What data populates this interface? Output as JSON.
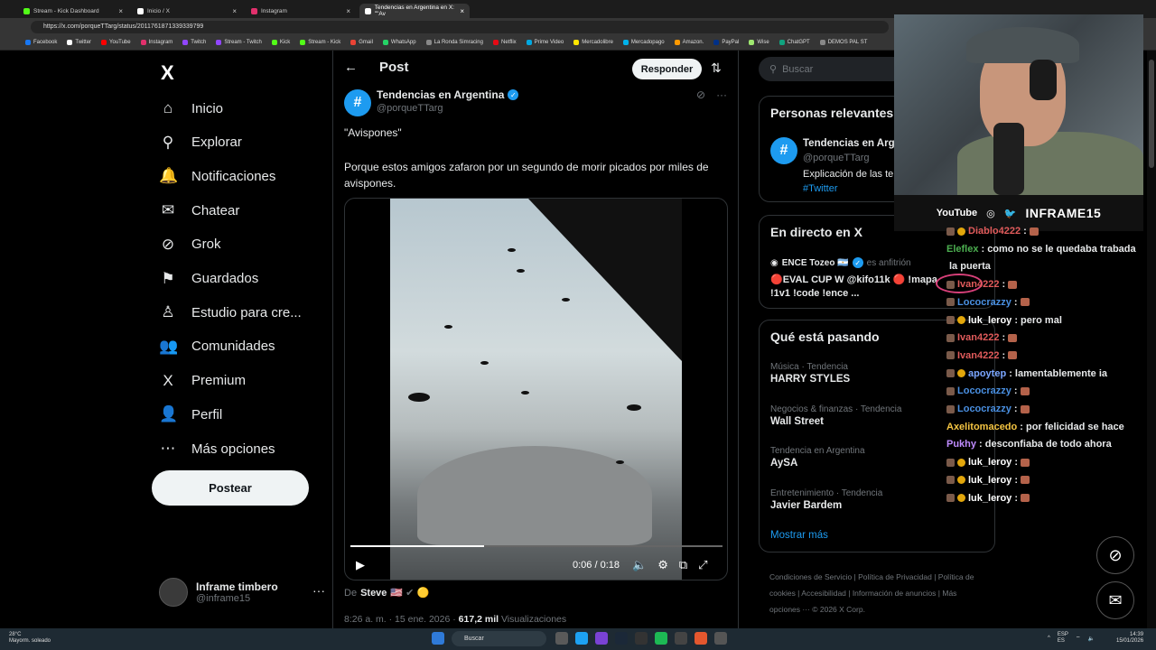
{
  "browser": {
    "tabs": [
      {
        "label": "Stream - Kick Dashboard",
        "color": "#53fc18"
      },
      {
        "label": "Inicio / X",
        "color": "#ffffff"
      },
      {
        "label": "Instagram",
        "color": "#e1306c"
      },
      {
        "label": "Tendencias en Argentina en X: \"\"Av",
        "color": "#ffffff"
      }
    ],
    "url": "https://x.com/porqueTTarg/status/2011761871339339799",
    "bookmarks": [
      "Facebook",
      "Twitter",
      "YouTube",
      "Instagram",
      "Twitch",
      "Stream - Twitch",
      "Kick",
      "Stream - Kick",
      "Gmail",
      "WhatsApp",
      "La Ronda Simracing",
      "Netflix",
      "Prime Video",
      "Mercadolibre",
      "Mercadopago",
      "Amazon.",
      "PayPal",
      "Wise",
      "ChatGPT",
      "DEMOS PAL ST"
    ]
  },
  "nav": {
    "items": [
      "Inicio",
      "Explorar",
      "Notificaciones",
      "Chatear",
      "Grok",
      "Guardados",
      "Estudio para cre...",
      "Comunidades",
      "Premium",
      "Perfil",
      "Más opciones"
    ],
    "icons": [
      "⌂",
      "⚲",
      "🔔",
      "✉",
      "⊘",
      "⚑",
      "♙",
      "👥",
      "X",
      "👤",
      "⋯"
    ],
    "post_label": "Postear",
    "profile_name": "Inframe timbero",
    "profile_handle": "@inframe15",
    "profile_more": "···"
  },
  "post": {
    "header": "Post",
    "reply_label": "Responder",
    "author_name": "Tendencias en Argentina",
    "author_handle": "@porqueTTarg",
    "title_text": "\"Avispones\"",
    "body": "Porque estos amigos zafaron por un segundo de morir picados por miles de avispones.",
    "video_time": "0:06 / 0:18",
    "video_progress": 0.36,
    "via_prefix": "De",
    "via_name": "Steve",
    "via_flags": "🇺🇸 ✔ 🟡",
    "time": "8:26 a. m. · 15 ene. 2026 ·",
    "views": "617,2 mil",
    "views_label": "Visualizaciones"
  },
  "sidebar": {
    "search_placeholder": "Buscar",
    "relevant_title": "Personas relevantes",
    "relevant_name": "Tendencias en Arge",
    "relevant_handle": "@porqueTTarg",
    "relevant_desc": "Explicación de las te",
    "relevant_tag": "#Twitter",
    "live_title": "En directo en X",
    "live_host": "ENCE Tozeo 🇦🇷",
    "live_host_role": "es anfitrión",
    "live_text": "🔴EVAL CUP W @kifo11k 🔴 !mapa !1v1 !code !ence ...",
    "trends_title": "Qué está pasando",
    "trends": [
      {
        "cat": "Música · Tendencia",
        "topic": "HARRY STYLES"
      },
      {
        "cat": "Negocios & finanzas · Tendencia",
        "topic": "Wall Street"
      },
      {
        "cat": "Tendencia en Argentina",
        "topic": "AySA"
      },
      {
        "cat": "Entretenimiento · Tendencia",
        "topic": "Javier Bardem"
      }
    ],
    "show_more": "Mostrar más",
    "footer": "Condiciones de Servicio | Política de Privacidad | Política de cookies | Accesibilidad | Información de anuncios | Más opciones ··· © 2026 X Corp."
  },
  "stream": {
    "youtube": "YouTube",
    "brand": "INFRAME15"
  },
  "chat": [
    {
      "user": "Diablo4222",
      "color": "#e05b5b",
      "msg": ":",
      "emote": true,
      "badge": "y"
    },
    {
      "user": "Eleflex",
      "color": "#4caf50",
      "msg": ": como no se le quedaba trabada",
      "badge": "none"
    },
    {
      "user": "",
      "color": "#ffffff",
      "msg": "la puerta",
      "badge": "none"
    },
    {
      "user": "Ivan4222",
      "color": "#e05b5b",
      "msg": ":",
      "emote": true,
      "badge": "b"
    },
    {
      "user": "Lococrazzy",
      "color": "#4a90e2",
      "msg": ":",
      "emote": true,
      "badge": "b"
    },
    {
      "user": "luk_leroy",
      "color": "#ffffff",
      "msg": ": pero mal",
      "badge": "y"
    },
    {
      "user": "Ivan4222",
      "color": "#e05b5b",
      "msg": ":",
      "emote": true,
      "badge": "b"
    },
    {
      "user": "Ivan4222",
      "color": "#e05b5b",
      "msg": ":",
      "emote": true,
      "badge": "b"
    },
    {
      "user": "apoytep",
      "color": "#7aa6ff",
      "msg": ": lamentablemente ia",
      "badge": "y"
    },
    {
      "user": "Lococrazzy",
      "color": "#4a90e2",
      "msg": ":",
      "emote": true,
      "badge": "b"
    },
    {
      "user": "Lococrazzy",
      "color": "#4a90e2",
      "msg": ":",
      "emote": true,
      "badge": "b"
    },
    {
      "user": "Axelitomacedo",
      "color": "#f5c542",
      "msg": ": por felicidad se hace",
      "badge": "none"
    },
    {
      "user": "Pukhy",
      "color": "#c08cff",
      "msg": ": desconfiaba de todo ahora",
      "badge": "none"
    },
    {
      "user": "luk_leroy",
      "color": "#ffffff",
      "msg": ":",
      "emote": true,
      "badge": "y"
    },
    {
      "user": "luk_leroy",
      "color": "#ffffff",
      "msg": ":",
      "emote": true,
      "badge": "y"
    },
    {
      "user": "luk_leroy",
      "color": "#ffffff",
      "msg": ":",
      "emote": true,
      "badge": "y"
    }
  ],
  "taskbar": {
    "temp": "28°C",
    "weather": "Mayorm. soleado",
    "search": "Buscar",
    "lang": "ESP",
    "lang2": "ES",
    "time": "14:39",
    "date": "15/01/2026"
  }
}
